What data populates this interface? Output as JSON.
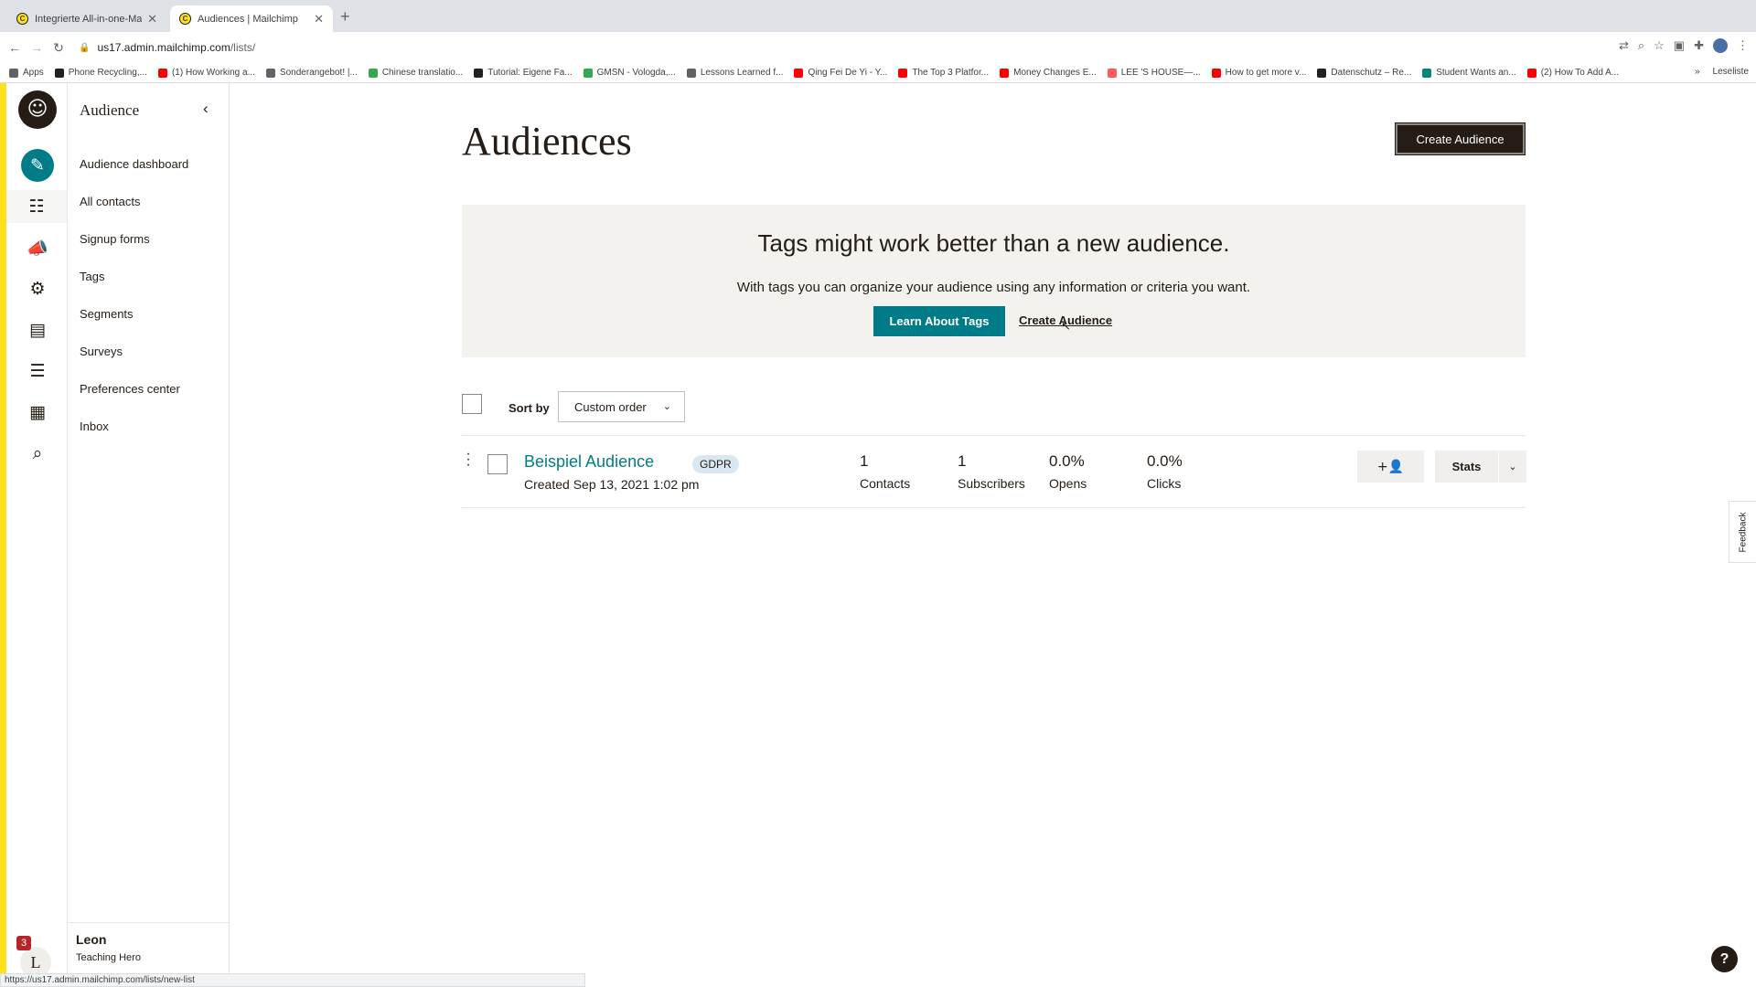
{
  "browser": {
    "tabs": [
      {
        "title": "Integrierte All-in-one-Marketin...",
        "active": false
      },
      {
        "title": "Audiences | Mailchimp",
        "active": true
      }
    ],
    "url_host": "us17.admin.mailchimp.com",
    "url_path": "/lists/",
    "bookmarks": [
      {
        "label": "Apps",
        "color": "#5f6368"
      },
      {
        "label": "Phone Recycling,...",
        "color": "#202124"
      },
      {
        "label": "(1) How Working a...",
        "color": "#ff0000"
      },
      {
        "label": "Sonderangebot! |...",
        "color": "#5f6368"
      },
      {
        "label": "Chinese translatio...",
        "color": "#34a853"
      },
      {
        "label": "Tutorial: Eigene Fa...",
        "color": "#202124"
      },
      {
        "label": "GMSN - Vologda,...",
        "color": "#34a853"
      },
      {
        "label": "Lessons Learned f...",
        "color": "#5f6368"
      },
      {
        "label": "Qing Fei De Yi - Y...",
        "color": "#ff0000"
      },
      {
        "label": "The Top 3 Platfor...",
        "color": "#ff0000"
      },
      {
        "label": "Money Changes E...",
        "color": "#ff0000"
      },
      {
        "label": "LEE 'S HOUSE—...",
        "color": "#ff5a5f"
      },
      {
        "label": "How to get more v...",
        "color": "#ff0000"
      },
      {
        "label": "Datenschutz – Re...",
        "color": "#202124"
      },
      {
        "label": "Student Wants an...",
        "color": "#00897b"
      },
      {
        "label": "(2) How To Add A...",
        "color": "#ff0000"
      }
    ],
    "reading_list": "Leseliste",
    "status_url": "https://us17.admin.mailchimp.com/lists/new-list"
  },
  "sidebar": {
    "title": "Audience",
    "items": [
      {
        "label": "Audience dashboard"
      },
      {
        "label": "All contacts"
      },
      {
        "label": "Signup forms"
      },
      {
        "label": "Tags"
      },
      {
        "label": "Segments"
      },
      {
        "label": "Surveys"
      },
      {
        "label": "Preferences center"
      },
      {
        "label": "Inbox"
      }
    ],
    "user_name": "Leon",
    "user_role": "Teaching Hero",
    "avatar_letter": "L",
    "notification_count": "3"
  },
  "main": {
    "title": "Audiences",
    "create_button": "Create Audience",
    "promo": {
      "heading": "Tags might work better than a new audience.",
      "text": "With tags you can organize your audience using any information or criteria you want.",
      "learn_button": "Learn About Tags",
      "create_link": "Create Audience"
    },
    "sort": {
      "label": "Sort by",
      "selected": "Custom order"
    },
    "audiences": [
      {
        "name": "Beispiel Audience",
        "badge": "GDPR",
        "created": "Created Sep 13, 2021 1:02 pm",
        "contacts": {
          "value": "1",
          "label": "Contacts"
        },
        "subscribers": {
          "value": "1",
          "label": "Subscribers"
        },
        "opens": {
          "value": "0.0%",
          "label": "Opens"
        },
        "clicks": {
          "value": "0.0%",
          "label": "Clicks"
        },
        "stats_button": "Stats"
      }
    ]
  },
  "widgets": {
    "feedback": "Feedback",
    "help": "?"
  },
  "colors": {
    "brand_yellow": "#ffe01b",
    "teal": "#007c89",
    "ink": "#241c15"
  }
}
